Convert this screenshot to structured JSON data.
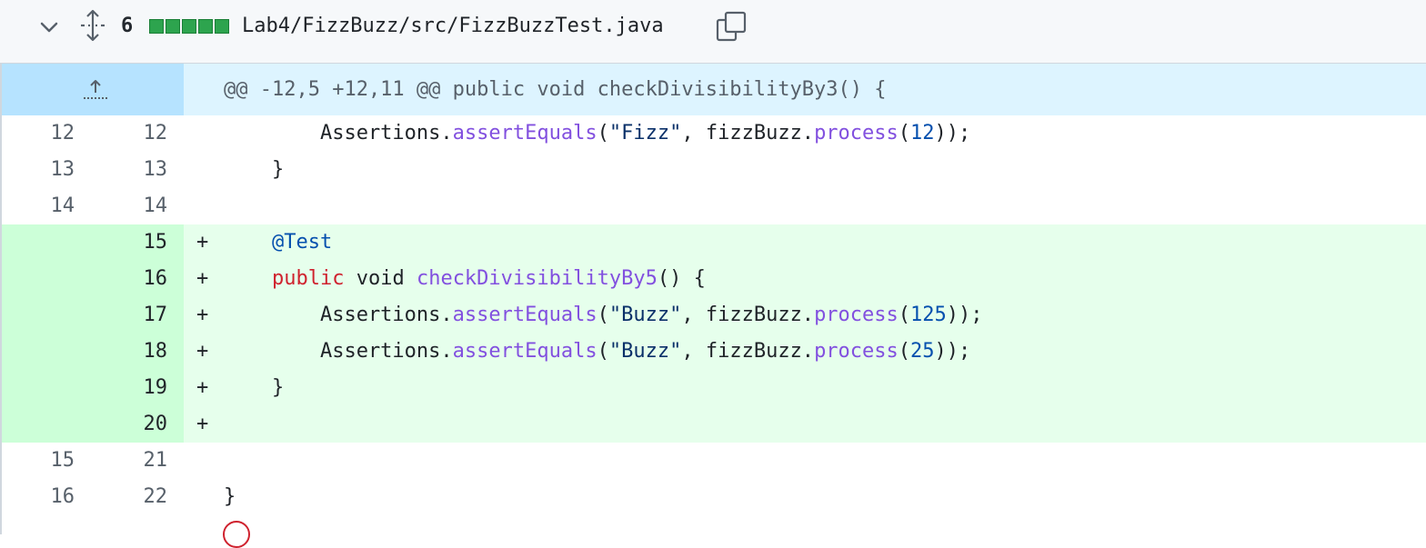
{
  "file_header": {
    "changes_count": "6",
    "path": "Lab4/FizzBuzz/src/FizzBuzzTest.java",
    "diffstat_blocks": 5,
    "accent_add": "#2da44e"
  },
  "hunk": {
    "header": "@@ -12,5 +12,11 @@ public void checkDivisibilityBy3() {"
  },
  "lines": [
    {
      "old": "12",
      "new": "12",
      "sign": "",
      "type": "context",
      "tokens": [
        {
          "t": "        Assertions."
        },
        {
          "t": "assertEquals",
          "c": "k-fn"
        },
        {
          "t": "("
        },
        {
          "t": "\"Fizz\"",
          "c": "k-str"
        },
        {
          "t": ", fizzBuzz."
        },
        {
          "t": "process",
          "c": "k-fn"
        },
        {
          "t": "("
        },
        {
          "t": "12",
          "c": "k-num"
        },
        {
          "t": "));"
        }
      ]
    },
    {
      "old": "13",
      "new": "13",
      "sign": "",
      "type": "context",
      "tokens": [
        {
          "t": "    }"
        }
      ]
    },
    {
      "old": "14",
      "new": "14",
      "sign": "",
      "type": "context",
      "tokens": [
        {
          "t": ""
        }
      ]
    },
    {
      "old": "",
      "new": "15",
      "sign": "+",
      "type": "add",
      "tokens": [
        {
          "t": "    "
        },
        {
          "t": "@Test",
          "c": "k-ann"
        }
      ]
    },
    {
      "old": "",
      "new": "16",
      "sign": "+",
      "type": "add",
      "tokens": [
        {
          "t": "    "
        },
        {
          "t": "public",
          "c": "k-mod"
        },
        {
          "t": " void "
        },
        {
          "t": "checkDivisibilityBy5",
          "c": "k-fn"
        },
        {
          "t": "() {"
        }
      ]
    },
    {
      "old": "",
      "new": "17",
      "sign": "+",
      "type": "add",
      "tokens": [
        {
          "t": "        Assertions."
        },
        {
          "t": "assertEquals",
          "c": "k-fn"
        },
        {
          "t": "("
        },
        {
          "t": "\"Buzz\"",
          "c": "k-str"
        },
        {
          "t": ", fizzBuzz."
        },
        {
          "t": "process",
          "c": "k-fn"
        },
        {
          "t": "("
        },
        {
          "t": "125",
          "c": "k-num"
        },
        {
          "t": "));"
        }
      ]
    },
    {
      "old": "",
      "new": "18",
      "sign": "+",
      "type": "add",
      "tokens": [
        {
          "t": "        Assertions."
        },
        {
          "t": "assertEquals",
          "c": "k-fn"
        },
        {
          "t": "("
        },
        {
          "t": "\"Buzz\"",
          "c": "k-str"
        },
        {
          "t": ", fizzBuzz."
        },
        {
          "t": "process",
          "c": "k-fn"
        },
        {
          "t": "("
        },
        {
          "t": "25",
          "c": "k-num"
        },
        {
          "t": "));"
        }
      ]
    },
    {
      "old": "",
      "new": "19",
      "sign": "+",
      "type": "add",
      "tokens": [
        {
          "t": "    }"
        }
      ]
    },
    {
      "old": "",
      "new": "20",
      "sign": "+",
      "type": "add",
      "tokens": [
        {
          "t": ""
        }
      ]
    },
    {
      "old": "15",
      "new": "21",
      "sign": "",
      "type": "context",
      "tokens": [
        {
          "t": ""
        }
      ]
    },
    {
      "old": "16",
      "new": "22",
      "sign": "",
      "type": "context",
      "tokens": [
        {
          "t": "}"
        }
      ]
    }
  ],
  "icons": {
    "collapse": "chevron-down-icon",
    "expand": "unfold-icon",
    "copy": "copy-icon",
    "expand_up": "expand-up-icon",
    "bottom_marker": "comment-marker-icon"
  }
}
